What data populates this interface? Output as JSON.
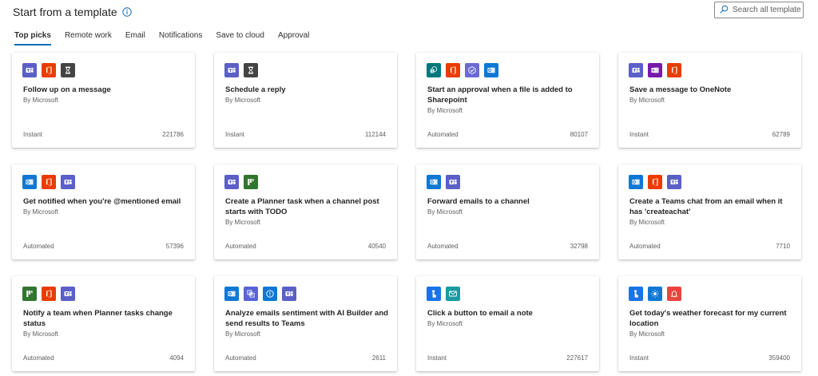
{
  "header": {
    "title": "Start from a template",
    "search_placeholder": "Search all templates"
  },
  "tabs": [
    {
      "label": "Top picks",
      "active": true
    },
    {
      "label": "Remote work",
      "active": false
    },
    {
      "label": "Email",
      "active": false
    },
    {
      "label": "Notifications",
      "active": false
    },
    {
      "label": "Save to cloud",
      "active": false
    },
    {
      "label": "Approval",
      "active": false
    }
  ],
  "icon_colors": {
    "teams": "#5b5fc7",
    "office": "#eb3c00",
    "delay": "#444444",
    "sharepoint": "#03787c",
    "approvals": "#6b69d6",
    "outlook": "#0f78d4",
    "onenote": "#7719aa",
    "planner": "#31752f",
    "ai_builder": "#5a62d6",
    "notifications": "#0f78d4",
    "button": "#1a73e8",
    "mail": "#1a9ba1",
    "weather": "#0f78d4",
    "alert": "#e8463d"
  },
  "templates": [
    {
      "title": "Follow up on a message",
      "author": "By Microsoft",
      "type": "Instant",
      "count": "221786",
      "icons": [
        "teams",
        "office",
        "delay"
      ]
    },
    {
      "title": "Schedule a reply",
      "author": "By Microsoft",
      "type": "Instant",
      "count": "112144",
      "icons": [
        "teams",
        "delay"
      ]
    },
    {
      "title": "Start an approval when a file is added to Sharepoint",
      "author": "By Microsoft",
      "type": "Automated",
      "count": "80107",
      "icons": [
        "sharepoint",
        "office",
        "approvals",
        "outlook"
      ]
    },
    {
      "title": "Save a message to OneNote",
      "author": "By Microsoft",
      "type": "Instant",
      "count": "62789",
      "icons": [
        "teams",
        "onenote",
        "office"
      ]
    },
    {
      "title": "Get notified when you're @mentioned email",
      "author": "By Microsoft",
      "type": "Automated",
      "count": "57396",
      "icons": [
        "outlook",
        "office",
        "teams"
      ]
    },
    {
      "title": "Create a Planner task when a channel post starts with TODO",
      "author": "By Microsoft",
      "type": "Automated",
      "count": "40540",
      "icons": [
        "teams",
        "planner"
      ]
    },
    {
      "title": "Forward emails to a channel",
      "author": "By Microsoft",
      "type": "Automated",
      "count": "32798",
      "icons": [
        "outlook",
        "teams"
      ]
    },
    {
      "title": "Create a Teams chat from an email when it has 'createachat'",
      "author": "By Microsoft",
      "type": "Automated",
      "count": "7710",
      "icons": [
        "outlook",
        "office",
        "teams"
      ]
    },
    {
      "title": "Notify a team when Planner tasks change status",
      "author": "By Microsoft",
      "type": "Automated",
      "count": "4094",
      "icons": [
        "planner",
        "office",
        "teams"
      ]
    },
    {
      "title": "Analyze emails sentiment with AI Builder and send results to Teams",
      "author": "By Microsoft",
      "type": "Automated",
      "count": "2611",
      "icons": [
        "outlook",
        "ai_builder",
        "notifications",
        "teams"
      ]
    },
    {
      "title": "Click a button to email a note",
      "author": "By Microsoft",
      "type": "Instant",
      "count": "227617",
      "icons": [
        "button",
        "mail"
      ]
    },
    {
      "title": "Get today's weather forecast for my current location",
      "author": "By Microsoft",
      "type": "Instant",
      "count": "359400",
      "icons": [
        "button",
        "weather",
        "alert"
      ]
    }
  ]
}
